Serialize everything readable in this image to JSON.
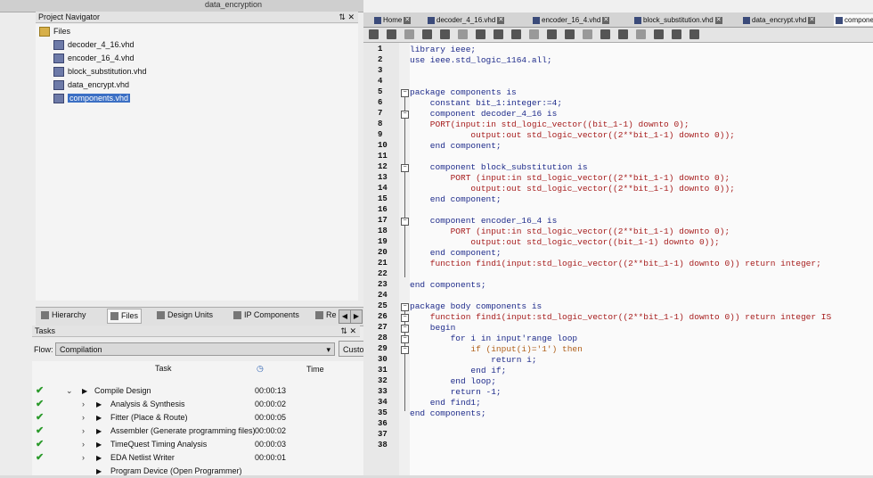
{
  "top_bar": {
    "project": "data_encryption"
  },
  "project_navigator": {
    "title": "Project Navigator",
    "controls": "⇅ ✕",
    "files_folder": "Files",
    "files": [
      "decoder_4_16.vhd",
      "encoder_16_4.vhd",
      "block_substitution.vhd",
      "data_encrypt.vhd",
      "components.vhd"
    ],
    "selected_index": 4
  },
  "nav_tabs": [
    "Hierarchy",
    "Files",
    "Design Units",
    "IP Components",
    "Re"
  ],
  "tasks": {
    "title": "Tasks",
    "controls": "⇅ ✕",
    "flow_label": "Flow:",
    "flow_value": "Compilation",
    "customize": "Customize...",
    "col_task": "Task",
    "col_time": "Time",
    "rows": [
      {
        "name": "Compile Design",
        "time": "00:00:13"
      },
      {
        "name": "Analysis & Synthesis",
        "time": "00:00:02"
      },
      {
        "name": "Fitter (Place & Route)",
        "time": "00:00:05"
      },
      {
        "name": "Assembler (Generate programming files)",
        "time": "00:00:02"
      },
      {
        "name": "TimeQuest Timing Analysis",
        "time": "00:00:03"
      },
      {
        "name": "EDA Netlist Writer",
        "time": "00:00:01"
      },
      {
        "name": "Program Device (Open Programmer)",
        "time": ""
      }
    ]
  },
  "doc_tabs": [
    "Home",
    "decoder_4_16.vhd",
    "encoder_16_4.vhd",
    "block_substitution.vhd",
    "data_encrypt.vhd",
    "components"
  ],
  "editor": {
    "line_numbers": [
      "1",
      "2",
      "3",
      "4",
      "5",
      "6",
      "7",
      "8",
      "9",
      "10",
      "11",
      "12",
      "13",
      "14",
      "15",
      "16",
      "17",
      "18",
      "19",
      "20",
      "21",
      "22",
      "23",
      "24",
      "25",
      "26",
      "27",
      "28",
      "29",
      "30",
      "31",
      "32",
      "33",
      "34",
      "35",
      "36",
      "37",
      "38"
    ],
    "lines": [
      "library ieee;",
      "use ieee.std_logic_1164.all;",
      "",
      "",
      "package components is",
      "    constant bit_1:integer:=4;",
      "    component decoder_4_16 is",
      "    PORT(input:in std_logic_vector((bit_1-1) downto 0);",
      "            output:out std_logic_vector((2**bit_1-1) downto 0));",
      "    end component;",
      "",
      "    component block_substitution is",
      "        PORT (input:in std_logic_vector((2**bit_1-1) downto 0);",
      "            output:out std_logic_vector((2**bit_1-1) downto 0));",
      "    end component;",
      "",
      "    component encoder_16_4 is",
      "        PORT (input:in std_logic_vector((2**bit_1-1) downto 0);",
      "            output:out std_logic_vector((bit_1-1) downto 0));",
      "    end component;",
      "    function find1(input:std_logic_vector((2**bit_1-1) downto 0)) return integer;",
      "",
      "end components;",
      "",
      "package body components is",
      "    function find1(input:std_logic_vector((2**bit_1-1) downto 0)) return integer IS",
      "    begin",
      "        for i in input'range loop",
      "            if (input(i)='1') then",
      "                return i;",
      "            end if;",
      "        end loop;",
      "        return -1;",
      "    end find1;",
      "end components;",
      "",
      "",
      ""
    ]
  }
}
